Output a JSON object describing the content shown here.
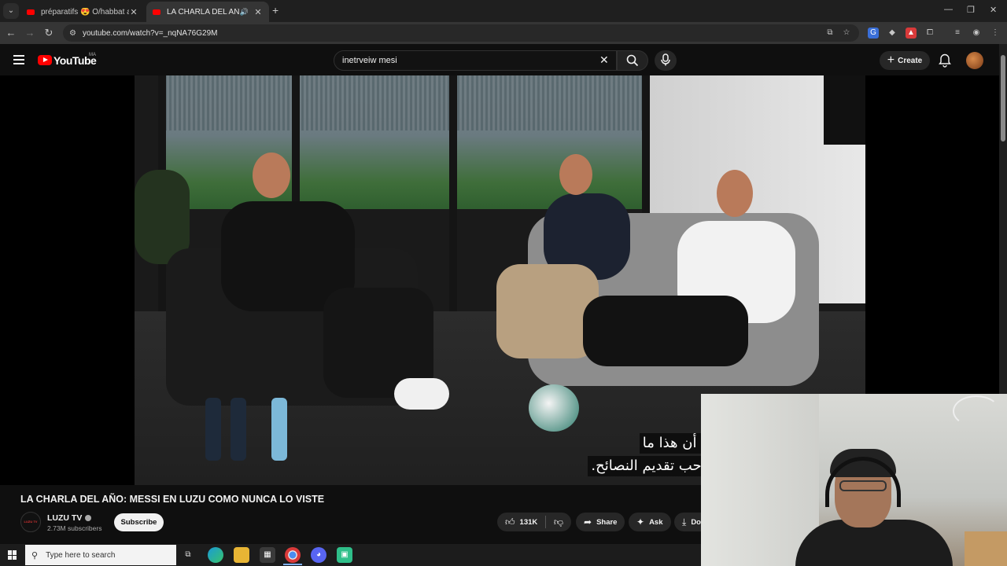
{
  "browser": {
    "tabs": [
      {
        "title": "préparatifs 😍 Ô/habbat abdel",
        "active": false
      },
      {
        "title": "LA CHARLA DEL AÑO: MES",
        "active": true
      }
    ],
    "url": "youtube.com/watch?v=_nqNA76G29M"
  },
  "youtube": {
    "logo_text": "YouTube",
    "country_code": "MA",
    "search_value": "inetrveiw mesi",
    "create_label": "Create"
  },
  "video": {
    "subtitle_line1": "لا؟ حسنًا، أقول دائمًا أن هذا ما",
    "subtitle_line2": "تقول ذلك، لكنني لا أحب تقديم النصائح."
  },
  "details": {
    "title": "LA CHARLA DEL AÑO: MESSI EN LUZU COMO NUNCA LO VISTE",
    "channel_name": "LUZU TV",
    "channel_avatar_text": "LUZU TV",
    "subscribers": "2.73M subscribers",
    "subscribe_label": "Subscribe",
    "likes": "131K",
    "share_label": "Share",
    "ask_label": "Ask",
    "download_label_partial": "Do"
  },
  "taskbar": {
    "search_placeholder": "Type here to search"
  },
  "colors": {
    "youtube_red": "#ff0000",
    "background": "#0f0f0f",
    "pill": "#272727"
  }
}
